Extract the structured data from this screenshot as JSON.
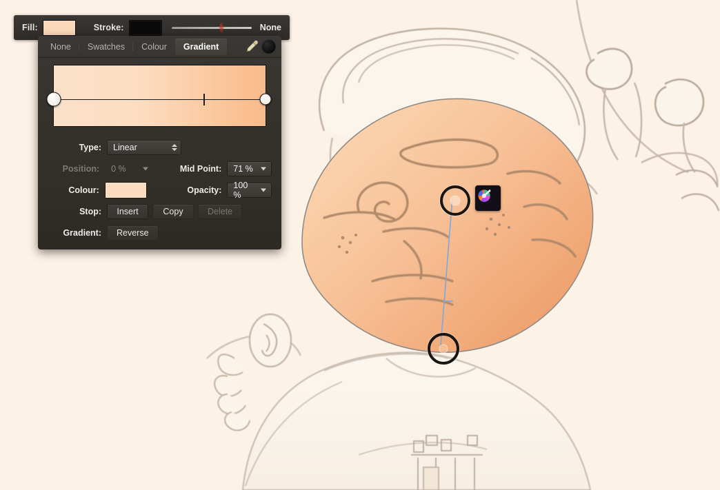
{
  "app": {
    "document_background": "#fdf2e6"
  },
  "fill_stroke_bar": {
    "fill_label": "Fill:",
    "fill_color": "#fcd9bb",
    "stroke_label": "Stroke:",
    "stroke_color": "#0a0a0a",
    "stroke_width_value_label": "None",
    "stroke_width_slider_percent": 62
  },
  "gradient_panel": {
    "tabs": [
      {
        "id": "none",
        "label": "None",
        "active": false
      },
      {
        "id": "swatches",
        "label": "Swatches",
        "active": false
      },
      {
        "id": "colour",
        "label": "Colour",
        "active": false
      },
      {
        "id": "gradient",
        "label": "Gradient",
        "active": true
      }
    ],
    "tools": {
      "eyedropper_icon": "eyedropper-icon",
      "current_colour_dot": "#0a0a0a"
    },
    "gradient_preview": {
      "start_color": "#fbe0c9",
      "end_color": "#f9ba8a",
      "stops": [
        {
          "position_percent": 0,
          "color": "#fbe0c9",
          "selected": true
        },
        {
          "position_percent": 100,
          "color": "#f9ba8a",
          "selected": false
        }
      ],
      "mid_point_percent": 71
    },
    "fields": {
      "type_label": "Type:",
      "type_value": "Linear",
      "position_label": "Position:",
      "position_value": "0 %",
      "position_disabled": true,
      "mid_point_label": "Mid Point:",
      "mid_point_value": "71 %",
      "colour_label": "Colour:",
      "colour_value": "#fcdcc0",
      "opacity_label": "Opacity:",
      "opacity_value": "100 %",
      "stop_label": "Stop:",
      "stop_insert": "Insert",
      "stop_copy": "Copy",
      "stop_delete": "Delete",
      "stop_delete_disabled": true,
      "gradient_label": "Gradient:",
      "gradient_reverse": "Reverse"
    }
  },
  "canvas": {
    "artwork_description": "Pencil sketch of a cartoon character with raised arm, holding a microphone; head shape filled with a peach-to-orange linear gradient",
    "selected_shape_fill_start": "#fbd2ab",
    "selected_shape_fill_end": "#f0a773",
    "gradient_widget": {
      "start_handle_label": "gradient-start-handle",
      "end_handle_label": "gradient-end-handle",
      "colour_wheel_button_label": "colour-wheel-button"
    }
  }
}
